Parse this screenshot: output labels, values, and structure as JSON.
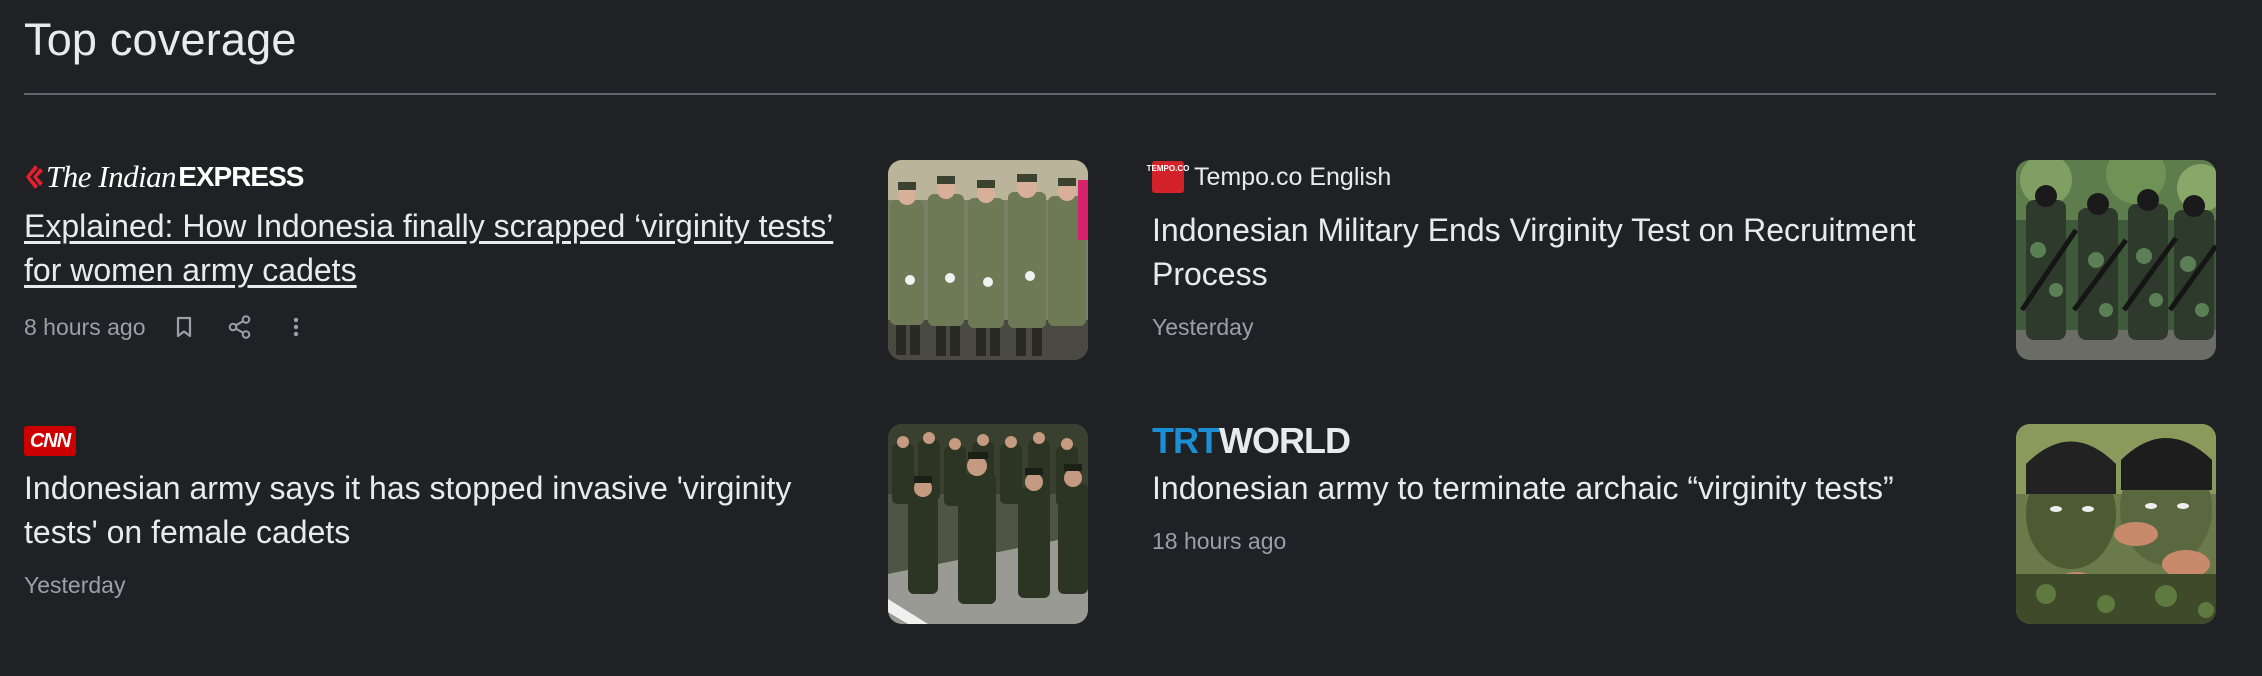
{
  "section": {
    "title": "Top coverage"
  },
  "articles": [
    {
      "source": {
        "name_part1": "The Indian",
        "name_part2": "EXPRESS"
      },
      "headline": "Explained: How Indonesia finally scrapped ‘virginity tests’ for women army cadets",
      "time": "8 hours ago",
      "thumbnail_icon": "women-cadets-marching-photo"
    },
    {
      "source": {
        "name": "Tempo.co English",
        "icon_text": "TEMPO.CO"
      },
      "headline": "Indonesian Military Ends Virginity Test on Recruitment Process",
      "time": "Yesterday",
      "thumbnail_icon": "soldiers-camouflage-photo"
    },
    {
      "source": {
        "name": "CNN"
      },
      "headline": "Indonesian army says it has stopped invasive 'virginity tests' on female cadets",
      "time": "Yesterday",
      "thumbnail_icon": "cadets-saluting-photo"
    },
    {
      "source": {
        "name_part1": "TRT",
        "name_part2": "WORLD"
      },
      "headline": "Indonesian army to terminate archaic “virginity tests”",
      "time": "18 hours ago",
      "thumbnail_icon": "camouflage-face-paint-photo"
    }
  ],
  "actions": {
    "bookmark": "bookmark-icon",
    "share": "share-icon",
    "more": "more-vert-icon"
  }
}
